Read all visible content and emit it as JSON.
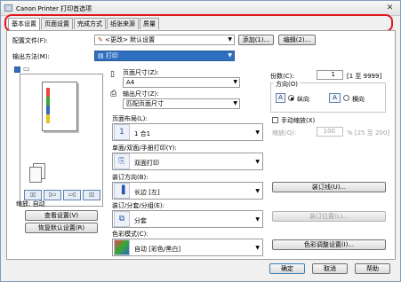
{
  "window": {
    "title": "Canon Printer 打印首选项",
    "close_glyph": "✕"
  },
  "tabs": [
    {
      "label": "基本设置"
    },
    {
      "label": "页面设置"
    },
    {
      "label": "完成方式"
    },
    {
      "label": "纸张来源"
    },
    {
      "label": "质量"
    }
  ],
  "profile": {
    "label": "配置文件(F):",
    "value": "<更改> 默认设置",
    "add_button": "添加(1)...",
    "edit_button": "编辑(2)..."
  },
  "output_method": {
    "label": "输出方法(M):",
    "value": "打印"
  },
  "page_size": {
    "label": "页面尺寸(Z):",
    "value": "A4"
  },
  "output_size": {
    "label": "输出尺寸(Z):",
    "value": "匹配页面尺寸"
  },
  "copies": {
    "label": "份数(C):",
    "value": "1",
    "range": "[1 至 9999]"
  },
  "orientation": {
    "label": "方向(O)",
    "portrait": "纵向",
    "landscape": "横向",
    "selected": "portrait"
  },
  "manual_scaling": {
    "label": "手动缩放(X)",
    "checked": false
  },
  "scaling": {
    "label": "缩放(Q):",
    "value": "100",
    "range": "% [25 至 200]"
  },
  "page_layout": {
    "label": "页面布局(L):",
    "value": "1 合1"
  },
  "print_style": {
    "label": "单面/双面/手册打印(Y):",
    "value": "双面打印"
  },
  "binding_location": {
    "label": "装订方向(B):",
    "value": "长边 [左]"
  },
  "binding_button": "装订线(U)...",
  "collate": {
    "label": "装订/分套/分组(E):",
    "value": "分套"
  },
  "staple_position_button": "装订位置(L)...",
  "color_mode": {
    "label": "色彩模式(C):",
    "value": "自动 [彩色/黑白]"
  },
  "color_button": "色彩调整设置(I)...",
  "preview": {
    "zoom_label": "缩放: 自动",
    "view_settings_button": "查看设置(V)",
    "restore_defaults_button": "恢复默认设置(R)"
  },
  "footer": {
    "ok": "确定",
    "cancel": "取消",
    "help": "帮助"
  },
  "colors": {
    "tab_highlight": "#e0141e",
    "accent": "#2356a8"
  }
}
